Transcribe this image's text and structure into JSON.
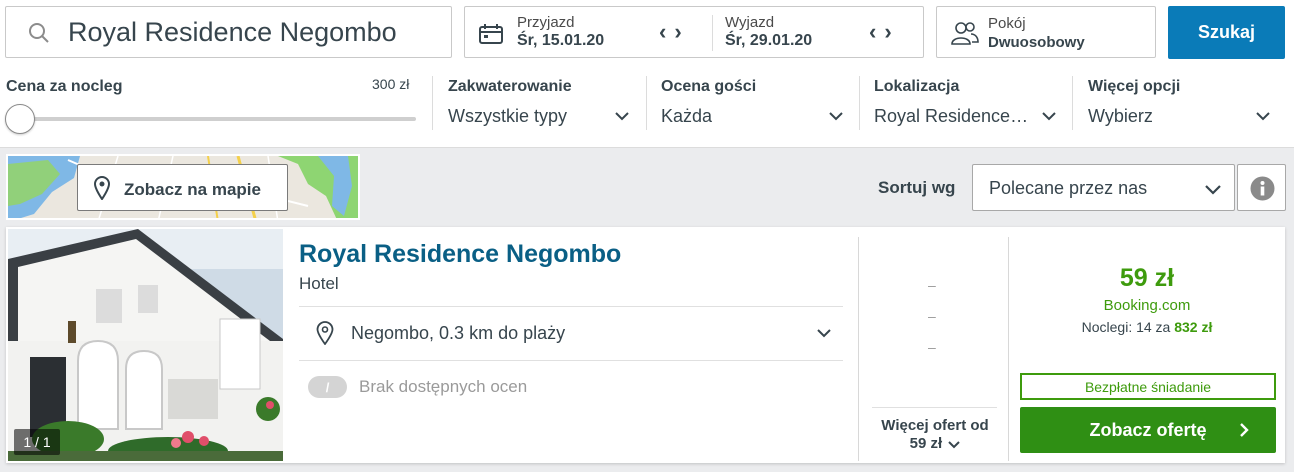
{
  "search": {
    "query": "Royal Residence Negombo"
  },
  "dates": {
    "checkin_label": "Przyjazd",
    "checkin_value": "Śr, 15.01.20",
    "checkout_label": "Wyjazd",
    "checkout_value": "Śr, 29.01.20"
  },
  "room": {
    "label": "Pokój",
    "value": "Dwuosobowy"
  },
  "search_button": "Szukaj",
  "filters": {
    "price_label": "Cena za nocleg",
    "price_max": "300 zł",
    "price_level": 0,
    "accommodation_label": "Zakwaterowanie",
    "accommodation_value": "Wszystkie typy",
    "rating_label": "Ocena gości",
    "rating_value": "Każda",
    "location_label": "Lokalizacja",
    "location_value": "Royal Residence…",
    "more_label": "Więcej opcji",
    "more_value": "Wybierz"
  },
  "map": {
    "button_label": "Zobacz na mapie"
  },
  "sort": {
    "label": "Sortuj wg",
    "value": "Polecane przez nas"
  },
  "result": {
    "photo_counter": "1 / 1",
    "name": "Royal Residence Negombo",
    "type": "Hotel",
    "location": "Negombo, 0.3 km do plaży",
    "rating_badge": "/",
    "rating_text": "Brak dostępnych ocen",
    "placeholder_dashes": [
      "–",
      "–",
      "–"
    ],
    "more_offers_line1": "Więcej ofert od",
    "more_offers_line2": "59 zł",
    "price": "59 zł",
    "provider": "Booking.com",
    "nights_prefix": "Noclegi: 14 za",
    "nights_total": "832 zł",
    "breakfast": "Bezpłatne śniadanie",
    "offer_button": "Zobacz ofertę"
  },
  "colors": {
    "brand_blue": "#0a7bb8",
    "title_blue": "#0a5f85",
    "price_green": "#3e9b0d",
    "button_green": "#2f8f14"
  },
  "icons": [
    "search-icon",
    "calendar-icon",
    "chevron-left-icon",
    "chevron-right-icon",
    "people-icon",
    "chevron-down-icon",
    "map-pin-icon",
    "info-icon",
    "chevron-right-icon"
  ]
}
